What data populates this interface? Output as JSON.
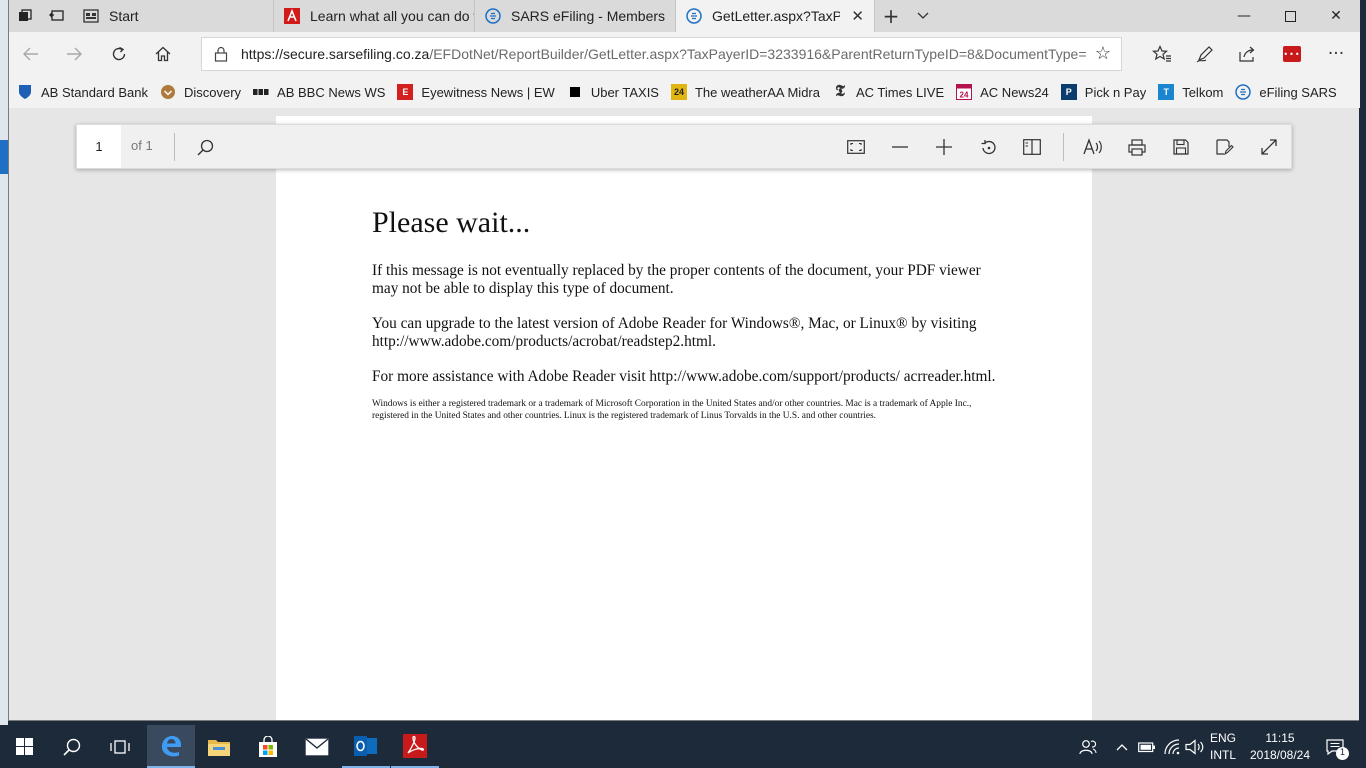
{
  "tabs": [
    {
      "label": "Start",
      "icon": "start-page-icon",
      "active": false
    },
    {
      "label": "Learn what all you can do w",
      "icon": "adobe-icon",
      "active": false
    },
    {
      "label": "SARS eFiling - Members",
      "icon": "efiling-icon",
      "active": false
    },
    {
      "label": "GetLetter.aspx?TaxPayer",
      "icon": "efiling-icon",
      "active": true
    }
  ],
  "address": {
    "host": "https://secure.sarsefiling.co.za",
    "path": "/EFDotNet/ReportBuilder/GetLetter.aspx?TaxPayerID=3233916&ParentReturnTypeID=8&DocumentType=L&Documer"
  },
  "favorites": [
    {
      "label": "AB Standard Bank",
      "icon": "standard-bank-icon",
      "color": "#1f5fb5"
    },
    {
      "label": "Discovery",
      "icon": "discovery-icon",
      "color": "#b07a3c"
    },
    {
      "label": "AB BBC News WS",
      "icon": "bbc-icon",
      "color": "#222222"
    },
    {
      "label": "Eyewitness News | EW",
      "icon": "ewn-icon",
      "color": "#d41f1f"
    },
    {
      "label": "Uber TAXIS",
      "icon": "uber-icon",
      "color": "#000000"
    },
    {
      "label": "The weatherAA Midra",
      "icon": "weather-icon",
      "color": "#e1b512"
    },
    {
      "label": "AC Times LIVE",
      "icon": "times-live-icon",
      "color": "#333333"
    },
    {
      "label": "AC News24",
      "icon": "news24-icon",
      "color": "#b3124f"
    },
    {
      "label": "Pick n Pay",
      "icon": "pick-n-pay-icon",
      "color": "#0c3b6e"
    },
    {
      "label": "Telkom",
      "icon": "telkom-icon",
      "color": "#1a86d0"
    },
    {
      "label": "eFiling SARS",
      "icon": "efiling-icon",
      "color": "#1f6fc4"
    }
  ],
  "pdf_toolbar": {
    "page_number": "1",
    "page_of": "of 1"
  },
  "document": {
    "heading": "Please wait...",
    "paragraphs": [
      "If this message is not eventually replaced by the proper contents of the document, your PDF viewer may not be able to display this type of document.",
      "You can upgrade to the latest version of Adobe Reader for Windows®, Mac, or Linux® by visiting  http://www.adobe.com/products/acrobat/readstep2.html.",
      "For more assistance with Adobe Reader visit  http://www.adobe.com/support/products/ acrreader.html."
    ],
    "fine_print": "Windows is either a registered trademark or a trademark of Microsoft Corporation in the United States and/or other countries. Mac is a trademark of Apple Inc., registered in the United States and other countries. Linux is the registered trademark of Linus Torvalds in the U.S. and other countries."
  },
  "taskbar": {
    "language_top": "ENG",
    "language_bottom": "INTL",
    "time": "11:15",
    "date": "2018/08/24",
    "notification_count": "1"
  },
  "colors": {
    "taskbar": "#1d2a3a",
    "accent": "#1f6fc4",
    "edge_blue": "#1f6fc4",
    "pdf_red": "#c81a1a"
  }
}
